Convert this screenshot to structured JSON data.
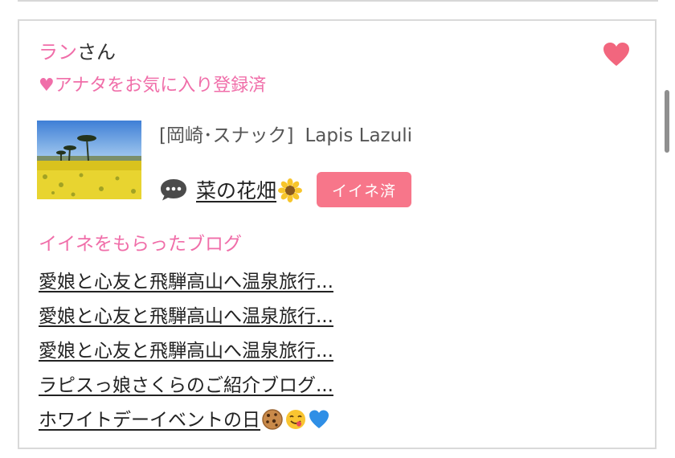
{
  "user": {
    "name": "ラン",
    "suffix": "さん",
    "favorite_status": "♥アナタをお気に入り登録済"
  },
  "shop": {
    "area_category": "[岡崎･スナック]",
    "name": "Lapis Lazuli"
  },
  "post": {
    "title": "菜の花畑",
    "title_emoji": "sunflower-icon",
    "like_badge": "イイネ済"
  },
  "blogs": {
    "heading": "イイネをもらったブログ",
    "items": [
      "愛娘と心友と飛騨高山へ温泉旅行...",
      "愛娘と心友と飛騨高山へ温泉旅行...",
      "愛娘と心友と飛騨高山へ温泉旅行...",
      "ラピスっ娘さくらのご紹介ブログ...",
      "ホワイトデーイベントの日"
    ],
    "last_item_emojis": [
      "cookie-icon",
      "yum-face-icon",
      "blue-heart-icon"
    ]
  },
  "colors": {
    "accent_pink": "#f06ea9",
    "badge_pink": "#f7768a",
    "heart": "#f2667e"
  }
}
